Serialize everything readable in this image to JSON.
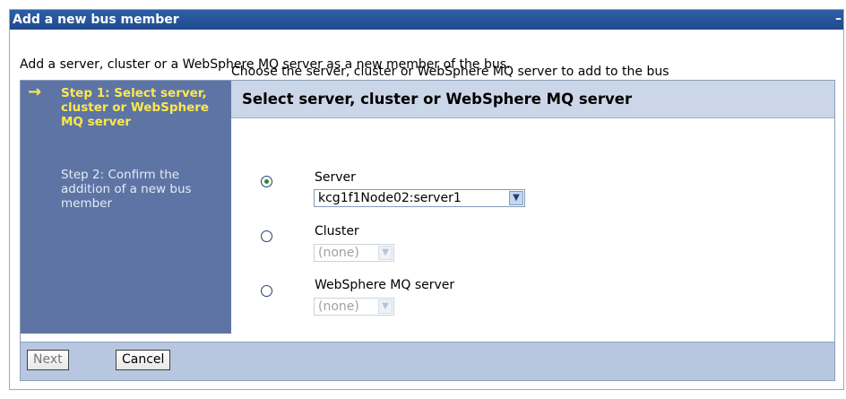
{
  "window": {
    "title": "Add a new bus member",
    "collapse_glyph": "–"
  },
  "intro_text": "Add a server, cluster or a WebSphere MQ server as a new member of the bus.",
  "wizard": {
    "steps": [
      {
        "label": "Step 1: Select server, cluster or WebSphere MQ server",
        "current": true
      },
      {
        "label": "Step 2: Confirm the addition of a new bus member",
        "current": false
      }
    ],
    "current_arrow": "→",
    "panel_title": "Select server, cluster or WebSphere MQ server",
    "instruction": "Choose the server, cluster or WebSphere MQ server to add to the bus",
    "options": [
      {
        "label": "Server",
        "selected": true,
        "select_value": "kcg1f1Node02:server1",
        "enabled": true
      },
      {
        "label": "Cluster",
        "selected": false,
        "select_value": "(none)",
        "enabled": false
      },
      {
        "label": "WebSphere MQ server",
        "selected": false,
        "select_value": "(none)",
        "enabled": false
      }
    ],
    "select_arrow": "▼"
  },
  "buttons": {
    "next": "Next",
    "cancel": "Cancel"
  },
  "colors": {
    "titlebar": "#2f5fa6",
    "steps_bg": "#5d74a5",
    "current_step": "#ffe84a",
    "panel_header": "#cbd6e8",
    "footer": "#b8c7e0"
  }
}
